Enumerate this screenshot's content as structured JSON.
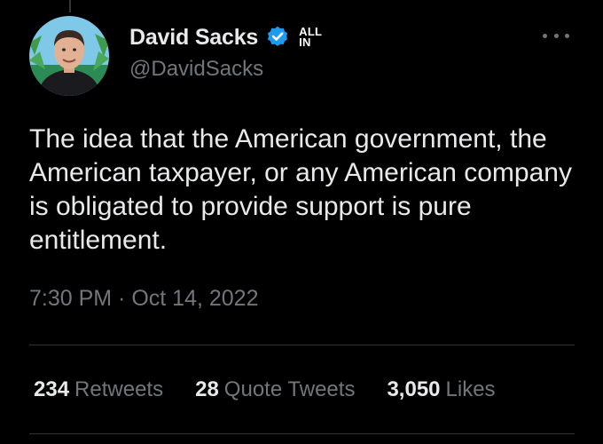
{
  "tweet": {
    "author": {
      "display_name": "David Sacks",
      "handle": "@DavidSacks",
      "verified": true,
      "affiliate_badge": {
        "line1": "ALL",
        "line2": "IN"
      },
      "avatar_icon": "user-avatar"
    },
    "text": "The idea that the American government, the American taxpayer, or any American company is obligated to provide support is pure entitlement.",
    "timestamp": "7:30 PM · Oct 14, 2022",
    "stats": {
      "retweets_count": "234",
      "retweets_label": "Retweets",
      "quotes_count": "28",
      "quotes_label": "Quote Tweets",
      "likes_count": "3,050",
      "likes_label": "Likes"
    },
    "icons": [
      "verified-badge-icon",
      "more-options-icon"
    ]
  },
  "colors": {
    "background": "#000000",
    "primary_text": "#e7e9ea",
    "secondary_text": "#71767b",
    "verified_blue": "#1d9bf0",
    "divider": "#2f3336"
  }
}
